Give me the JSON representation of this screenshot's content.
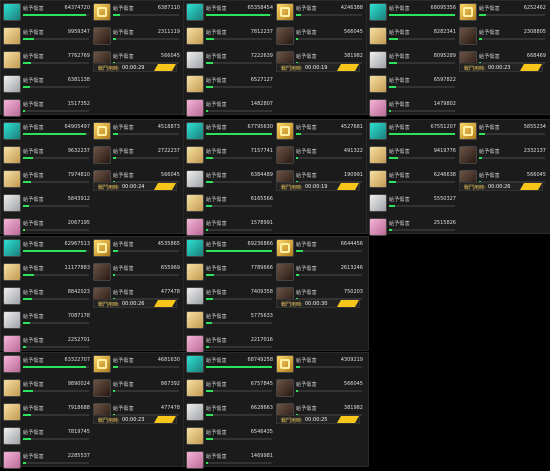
{
  "ui": {
    "damage_label": "給予傷害",
    "timer_label": "戰鬥用時:"
  },
  "battles": [
    {
      "timer": "00:00:29",
      "left": [
        {
          "portrait": "teal-girl-icon",
          "value": "64374720",
          "bar": 0.96
        },
        {
          "portrait": "blonde-girl-icon",
          "value": "9959347",
          "bar": 0.16
        },
        {
          "portrait": "blonde-girl-icon",
          "value": "7762769",
          "bar": 0.12
        },
        {
          "portrait": "white-hair-girl-icon",
          "value": "6381138",
          "bar": 0.1
        },
        {
          "portrait": "pink-girl-icon",
          "value": "1517352",
          "bar": 0.03
        }
      ],
      "right": [
        {
          "portrait": "crown-warrior-icon",
          "value": "6387110",
          "bar": 0.1
        },
        {
          "portrait": "bearded-man-icon",
          "value": "2311119",
          "bar": 0.04
        },
        {
          "portrait": "bearded-man-icon",
          "value": "566045",
          "bar": 0.01
        }
      ]
    },
    {
      "timer": "00:00:19",
      "left": [
        {
          "portrait": "teal-girl-icon",
          "value": "65358454",
          "bar": 0.97
        },
        {
          "portrait": "blonde-girl-icon",
          "value": "7812237",
          "bar": 0.12
        },
        {
          "portrait": "white-hair-girl-icon",
          "value": "7222639",
          "bar": 0.11
        },
        {
          "portrait": "blonde-girl-icon",
          "value": "6527127",
          "bar": 0.1
        },
        {
          "portrait": "pink-girl-icon",
          "value": "1482807",
          "bar": 0.03
        }
      ],
      "right": [
        {
          "portrait": "crown-warrior-icon",
          "value": "4246388",
          "bar": 0.07
        },
        {
          "portrait": "bearded-man-icon",
          "value": "566045",
          "bar": 0.01
        },
        {
          "portrait": "bearded-man-icon",
          "value": "381982",
          "bar": 0.01
        }
      ]
    },
    {
      "timer": "00:00:23",
      "left": [
        {
          "portrait": "teal-girl-icon",
          "value": "68095356",
          "bar": 1.0
        },
        {
          "portrait": "blonde-girl-icon",
          "value": "8282341",
          "bar": 0.13
        },
        {
          "portrait": "white-hair-girl-icon",
          "value": "8095289",
          "bar": 0.12
        },
        {
          "portrait": "blonde-girl-icon",
          "value": "6597822",
          "bar": 0.1
        },
        {
          "portrait": "pink-girl-icon",
          "value": "1479802",
          "bar": 0.03
        }
      ],
      "right": [
        {
          "portrait": "crown-warrior-icon",
          "value": "6252462",
          "bar": 0.1
        },
        {
          "portrait": "bearded-man-icon",
          "value": "2308805",
          "bar": 0.04
        },
        {
          "portrait": "bearded-man-icon",
          "value": "668469",
          "bar": 0.01
        }
      ]
    },
    {
      "timer": "00:00:24",
      "left": [
        {
          "portrait": "teal-girl-icon",
          "value": "64905497",
          "bar": 0.96
        },
        {
          "portrait": "blonde-girl-icon",
          "value": "9632237",
          "bar": 0.15
        },
        {
          "portrait": "blonde-girl-icon",
          "value": "7974810",
          "bar": 0.12
        },
        {
          "portrait": "white-hair-girl-icon",
          "value": "5843912",
          "bar": 0.09
        },
        {
          "portrait": "pink-girl-icon",
          "value": "2067195",
          "bar": 0.03
        }
      ],
      "right": [
        {
          "portrait": "crown-warrior-icon",
          "value": "4518873",
          "bar": 0.07
        },
        {
          "portrait": "bearded-man-icon",
          "value": "2722237",
          "bar": 0.04
        },
        {
          "portrait": "bearded-man-icon",
          "value": "566045",
          "bar": 0.01
        }
      ]
    },
    {
      "timer": "00:00:19",
      "left": [
        {
          "portrait": "teal-girl-icon",
          "value": "67795630",
          "bar": 1.0
        },
        {
          "portrait": "blonde-girl-icon",
          "value": "7157741",
          "bar": 0.11
        },
        {
          "portrait": "white-hair-girl-icon",
          "value": "6384489",
          "bar": 0.1
        },
        {
          "portrait": "blonde-girl-icon",
          "value": "6165566",
          "bar": 0.09
        },
        {
          "portrait": "pink-girl-icon",
          "value": "1578991",
          "bar": 0.03
        }
      ],
      "right": [
        {
          "portrait": "crown-warrior-icon",
          "value": "4527681",
          "bar": 0.07
        },
        {
          "portrait": "bearded-man-icon",
          "value": "491322",
          "bar": 0.01
        },
        {
          "portrait": "bearded-man-icon",
          "value": "190991",
          "bar": 0.01
        }
      ]
    },
    {
      "timer": "00:00:26",
      "left": [
        {
          "portrait": "teal-girl-icon",
          "value": "67551207",
          "bar": 1.0
        },
        {
          "portrait": "blonde-girl-icon",
          "value": "9419776",
          "bar": 0.14
        },
        {
          "portrait": "blonde-girl-icon",
          "value": "6246638",
          "bar": 0.1
        },
        {
          "portrait": "white-hair-girl-icon",
          "value": "5550327",
          "bar": 0.09
        },
        {
          "portrait": "pink-girl-icon",
          "value": "2515826",
          "bar": 0.04
        }
      ],
      "right": [
        {
          "portrait": "crown-warrior-icon",
          "value": "5855234",
          "bar": 0.09
        },
        {
          "portrait": "bearded-man-icon",
          "value": "2332137",
          "bar": 0.04
        },
        {
          "portrait": "bearded-man-icon",
          "value": "566045",
          "bar": 0.01
        }
      ]
    },
    {
      "timer": "00:00:26",
      "left": [
        {
          "portrait": "teal-girl-icon",
          "value": "62967513",
          "bar": 0.95
        },
        {
          "portrait": "blonde-girl-icon",
          "value": "11177883",
          "bar": 0.17
        },
        {
          "portrait": "white-hair-girl-icon",
          "value": "8842023",
          "bar": 0.13
        },
        {
          "portrait": "white-hair-girl-icon",
          "value": "7087178",
          "bar": 0.11
        },
        {
          "portrait": "pink-girl-icon",
          "value": "2252701",
          "bar": 0.04
        }
      ],
      "right": [
        {
          "portrait": "crown-warrior-icon",
          "value": "4535865",
          "bar": 0.07
        },
        {
          "portrait": "bearded-man-icon",
          "value": "655969",
          "bar": 0.01
        },
        {
          "portrait": "bearded-man-icon",
          "value": "477478",
          "bar": 0.01
        }
      ]
    },
    {
      "timer": "00:00:30",
      "left": [
        {
          "portrait": "teal-girl-icon",
          "value": "69236866",
          "bar": 1.0
        },
        {
          "portrait": "blonde-girl-icon",
          "value": "7789666",
          "bar": 0.12
        },
        {
          "portrait": "white-hair-girl-icon",
          "value": "7409358",
          "bar": 0.11
        },
        {
          "portrait": "blonde-girl-icon",
          "value": "5775633",
          "bar": 0.09
        },
        {
          "portrait": "pink-girl-icon",
          "value": "2217016",
          "bar": 0.04
        }
      ],
      "right": [
        {
          "portrait": "crown-warrior-icon",
          "value": "6644456",
          "bar": 0.1
        },
        {
          "portrait": "bearded-man-icon",
          "value": "2613246",
          "bar": 0.04
        },
        {
          "portrait": "bearded-man-icon",
          "value": "750203",
          "bar": 0.01
        }
      ]
    },
    {
      "timer": "00:00:23",
      "left": [
        {
          "portrait": "pink-girl-icon",
          "value": "63322707",
          "bar": 0.95
        },
        {
          "portrait": "blonde-girl-icon",
          "value": "9890024",
          "bar": 0.15
        },
        {
          "portrait": "blonde-girl-icon",
          "value": "7918688",
          "bar": 0.12
        },
        {
          "portrait": "white-hair-girl-icon",
          "value": "7819745",
          "bar": 0.12
        },
        {
          "portrait": "pink-girl-icon",
          "value": "2285537",
          "bar": 0.04
        }
      ],
      "right": [
        {
          "portrait": "crown-warrior-icon",
          "value": "4681630",
          "bar": 0.07
        },
        {
          "portrait": "bearded-man-icon",
          "value": "867392",
          "bar": 0.01
        },
        {
          "portrait": "bearded-man-icon",
          "value": "477478",
          "bar": 0.01
        }
      ]
    },
    {
      "timer": "00:00:25",
      "left": [
        {
          "portrait": "teal-girl-icon",
          "value": "68749258",
          "bar": 1.0
        },
        {
          "portrait": "blonde-girl-icon",
          "value": "6757845",
          "bar": 0.1
        },
        {
          "portrait": "white-hair-girl-icon",
          "value": "6628663",
          "bar": 0.1
        },
        {
          "portrait": "blonde-girl-icon",
          "value": "6546435",
          "bar": 0.1
        },
        {
          "portrait": "pink-girl-icon",
          "value": "1469981",
          "bar": 0.03
        }
      ],
      "right": [
        {
          "portrait": "crown-warrior-icon",
          "value": "4309219",
          "bar": 0.06
        },
        {
          "portrait": "bearded-man-icon",
          "value": "566045",
          "bar": 0.01
        },
        {
          "portrait": "bearded-man-icon",
          "value": "381982",
          "bar": 0.01
        }
      ]
    }
  ]
}
